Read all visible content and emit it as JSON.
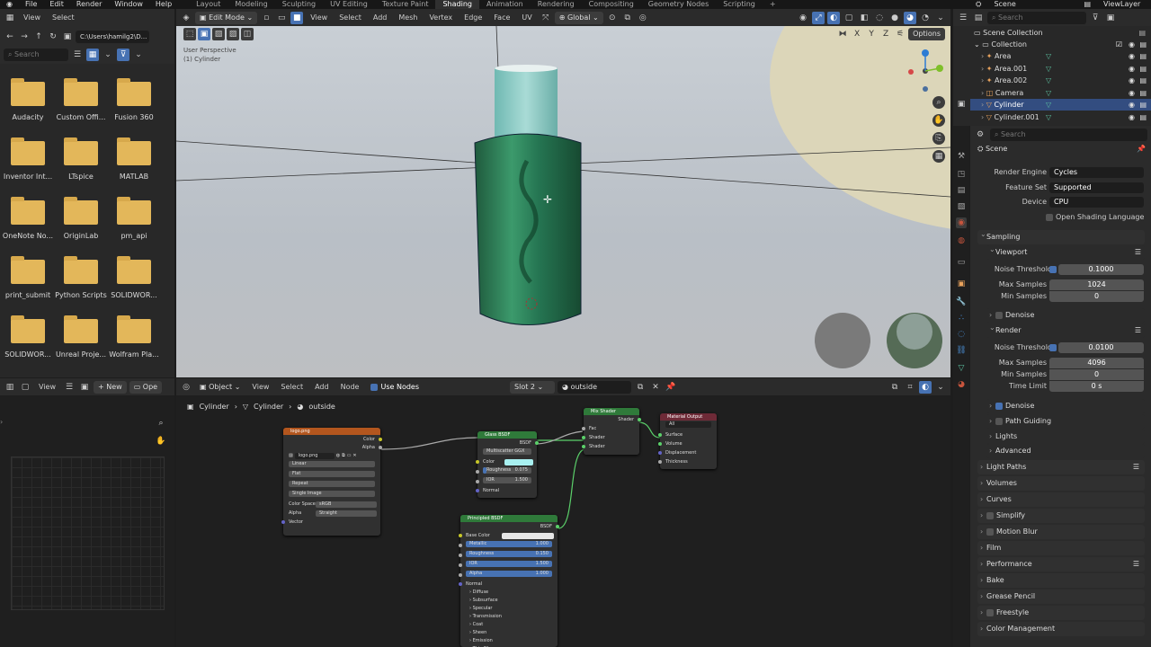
{
  "menu": [
    "File",
    "Edit",
    "Render",
    "Window",
    "Help"
  ],
  "workspaces": [
    "Layout",
    "Modeling",
    "Sculpting",
    "UV Editing",
    "Texture Paint",
    "Shading",
    "Animation",
    "Rendering",
    "Compositing",
    "Geometry Nodes",
    "Scripting"
  ],
  "active_workspace": "Shading",
  "scene_name": "Scene",
  "view_layer": "ViewLayer",
  "file_browser": {
    "header": [
      "View",
      "Select"
    ],
    "path": "C:\\Users\\hamilg2\\D...",
    "search_placeholder": "Search",
    "folders": [
      "Audacity",
      "Custom Offi...",
      "Fusion 360",
      "Inventor Int...",
      "LTspice",
      "MATLAB",
      "OneNote No...",
      "OriginLab",
      "pm_api",
      "print_submit",
      "Python Scripts",
      "SOLIDWOR...",
      "SOLIDWOR...",
      "Unreal Proje...",
      "Wolfram Pla..."
    ]
  },
  "viewport": {
    "mode": "Edit Mode",
    "menus": [
      "View",
      "Select",
      "Add",
      "Mesh",
      "Vertex",
      "Edge",
      "Face",
      "UV"
    ],
    "orientation": "Global",
    "perspective": "User Perspective",
    "object_label": "(1) Cylinder",
    "axes": [
      "X",
      "Y",
      "Z"
    ],
    "options": "Options"
  },
  "image_editor": {
    "view": "View",
    "new": "New",
    "open": "Ope"
  },
  "node_editor": {
    "object": "Object",
    "menus": [
      "View",
      "Select",
      "Add",
      "Node"
    ],
    "use_nodes": "Use Nodes",
    "slot": "Slot 2",
    "material": "outside",
    "breadcrumb": [
      "Cylinder",
      "Cylinder",
      "outside"
    ],
    "image_node": {
      "title": "logo.png",
      "outputs": [
        "Color",
        "Alpha"
      ],
      "image": "logo.png",
      "interp": "Linear",
      "proj": "Flat",
      "ext": "Repeat",
      "source": "Single Image",
      "cs_label": "Color Space",
      "cs": "sRGB",
      "alpha_label": "Alpha",
      "alpha": "Straight",
      "input": "Vector"
    },
    "glass_node": {
      "title": "Glass BSDF",
      "output": "BSDF",
      "dist": "Multiscatter GGX",
      "color": "Color",
      "rough_label": "Roughness",
      "rough": "0.075",
      "ior_label": "IOR",
      "ior": "1.500",
      "normal": "Normal"
    },
    "mix_node": {
      "title": "Mix Shader",
      "output": "Shader",
      "inputs": [
        "Fac",
        "Shader",
        "Shader"
      ]
    },
    "output_node": {
      "title": "Material Output",
      "target": "All",
      "inputs": [
        "Surface",
        "Volume",
        "Displacement",
        "Thickness"
      ]
    },
    "principled_node": {
      "title": "Principled BSDF",
      "output": "BSDF",
      "base": "Base Color",
      "fields": [
        {
          "label": "Metallic",
          "value": "1.000"
        },
        {
          "label": "Roughness",
          "value": "0.150"
        },
        {
          "label": "IOR",
          "value": "1.500"
        },
        {
          "label": "Alpha",
          "value": "1.000"
        }
      ],
      "normal": "Normal",
      "panels": [
        "Diffuse",
        "Subsurface",
        "Specular",
        "Transmission",
        "Coat",
        "Sheen",
        "Emission",
        "Thin Film"
      ]
    }
  },
  "outliner": {
    "search_placeholder": "Search",
    "root": "Scene Collection",
    "collection": "Collection",
    "items": [
      "Area",
      "Area.001",
      "Area.002",
      "Camera",
      "Cylinder",
      "Cylinder.001"
    ],
    "selected": "Cylinder"
  },
  "properties": {
    "search_placeholder": "Search",
    "context": "Scene",
    "render_engine_label": "Render Engine",
    "render_engine": "Cycles",
    "feature_set_label": "Feature Set",
    "feature_set": "Supported",
    "device_label": "Device",
    "device": "CPU",
    "osl": "Open Shading Language",
    "sampling": "Sampling",
    "viewport": "Viewport",
    "noise_label": "Noise Threshold",
    "vp_noise": "0.1000",
    "max_samples_label": "Max Samples",
    "vp_max": "1024",
    "min_samples_label": "Min Samples",
    "vp_min": "0",
    "denoise": "Denoise",
    "render": "Render",
    "r_noise": "0.0100",
    "r_max": "4096",
    "r_min": "0",
    "time_limit_label": "Time Limit",
    "time_limit": "0 s",
    "path_guiding": "Path Guiding",
    "lights": "Lights",
    "advanced": "Advanced",
    "sections": [
      "Light Paths",
      "Volumes",
      "Curves",
      "Simplify",
      "Motion Blur",
      "Film",
      "Performance",
      "Bake",
      "Grease Pencil",
      "Freestyle",
      "Color Management"
    ]
  },
  "colors": {
    "accent": "#4772b3",
    "folder": "#e3b75a",
    "glass_header": "#2f7a3a",
    "mix_header": "#2f7a3a",
    "output_header": "#6e2a37",
    "image_header": "#b3561e"
  }
}
